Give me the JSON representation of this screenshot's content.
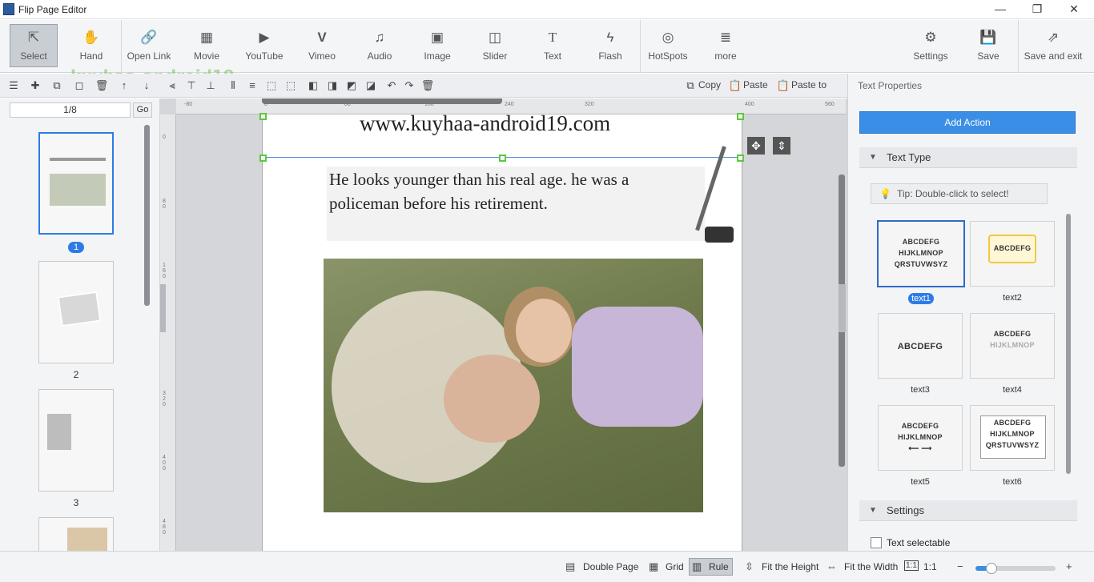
{
  "window": {
    "title": "Flip Page Editor",
    "minimize": "—",
    "restore": "❐",
    "close": "✕"
  },
  "toolbar": {
    "tools": [
      {
        "label": "Select",
        "icon": "⇱"
      },
      {
        "label": "Hand",
        "icon": "✋"
      },
      {
        "label": "Open Link",
        "icon": "🔗"
      },
      {
        "label": "Movie",
        "icon": "▦"
      },
      {
        "label": "YouTube",
        "icon": "▶"
      },
      {
        "label": "Vimeo",
        "icon": "V"
      },
      {
        "label": "Audio",
        "icon": "♫"
      },
      {
        "label": "Image",
        "icon": "▣"
      },
      {
        "label": "Slider",
        "icon": "◫"
      },
      {
        "label": "Text",
        "icon": "T"
      },
      {
        "label": "Flash",
        "icon": "ϟ"
      },
      {
        "label": "HotSpots",
        "icon": "◎"
      },
      {
        "label": "more",
        "icon": "≣"
      }
    ],
    "right": [
      {
        "label": "Settings",
        "icon": "⚙"
      },
      {
        "label": "Save",
        "icon": "💾"
      },
      {
        "label": "Save and exit",
        "icon": "⇗"
      }
    ]
  },
  "watermark": "kuyhaa-android19",
  "edit_bar": {
    "copy": "Copy",
    "paste": "Paste",
    "paste_to": "Paste to"
  },
  "pages": {
    "indicator": "1/8",
    "go": "Go",
    "thumbs": [
      "1",
      "2",
      "3"
    ]
  },
  "ruler": {
    "h": [
      "-80",
      "0",
      "80",
      "160",
      "240",
      "320",
      "400",
      "480",
      "560"
    ],
    "v": [
      "0",
      "8 0",
      "1 6 0",
      "0",
      "3 2 0",
      "4 0 0",
      "4 8 0"
    ]
  },
  "canvas": {
    "url_text": "www.kuyhaa-android19.com",
    "body_text": "He looks younger than his real age. he was a policeman before his retirement."
  },
  "right_panel": {
    "heading": "Text Properties",
    "add_action": "Add Action",
    "text_type": "Text Type",
    "tip": "Tip: Double-click to select!",
    "styles": [
      {
        "label": "text1",
        "sample": [
          "ABCDEFG",
          "HIJKLMNOP",
          "QRSTUVWSYZ"
        ]
      },
      {
        "label": "text2",
        "sample": [
          "ABCDEFG"
        ]
      },
      {
        "label": "text3",
        "sample": [
          "ABCDEFG"
        ]
      },
      {
        "label": "text4",
        "sample": [
          "ABCDEFG",
          "HIJKLMNOP"
        ]
      },
      {
        "label": "text5",
        "sample": [
          "ABCDEFG",
          "HIJKLMNOP",
          "⟵   ⟶"
        ]
      },
      {
        "label": "text6",
        "sample": [
          "ABCDEFG",
          "HIJKLMNOP",
          "QRSTUVWSYZ"
        ]
      }
    ],
    "settings": "Settings",
    "text_selectable": "Text selectable"
  },
  "status": {
    "double_page": "Double Page",
    "grid": "Grid",
    "rule": "Rule",
    "fit_height": "Fit the Height",
    "fit_width": "Fit the Width",
    "one_to_one": "1:1",
    "zoom_fraction": 0.2
  },
  "colors": {
    "accent": "#3a8ee6",
    "selection": "#2d7be5",
    "handle": "#5cc93a"
  }
}
